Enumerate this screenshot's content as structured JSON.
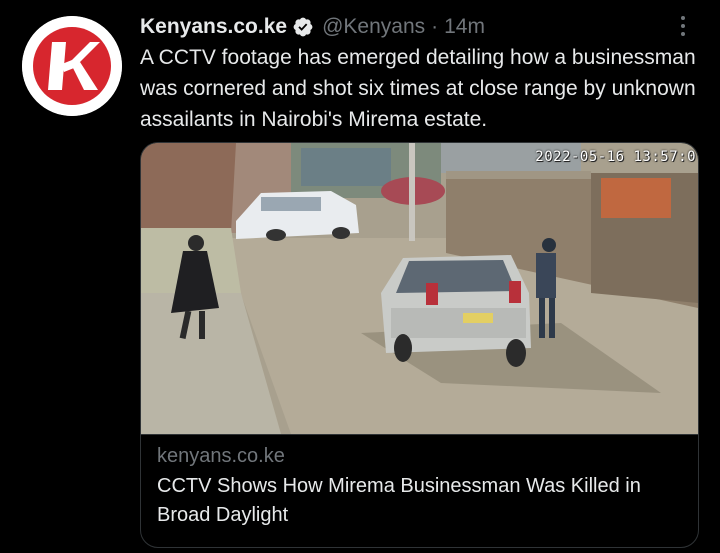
{
  "tweet": {
    "display_name": "Kenyans.co.ke",
    "handle": "@Kenyans",
    "separator": "·",
    "time": "14m",
    "text": "A CCTV footage has emerged detailing how a businessman was cornered and shot six times at close range by unknown assailants in Nairobi's Mirema estate.",
    "avatar_icon": "kenyans-k-logo",
    "verified_icon": "verified-badge-icon",
    "more_icon": "more-vertical-icon"
  },
  "card": {
    "timestamp_overlay": "2022-05-16 13:57:0",
    "domain": "kenyans.co.ke",
    "title": "CCTV Shows How Mirema Businessman Was Killed in Broad Daylight"
  },
  "colors": {
    "background": "#000000",
    "primary_text": "#e7e9ea",
    "secondary_text": "#71767b",
    "border": "#2f3336",
    "logo_red": "#d7262e"
  }
}
